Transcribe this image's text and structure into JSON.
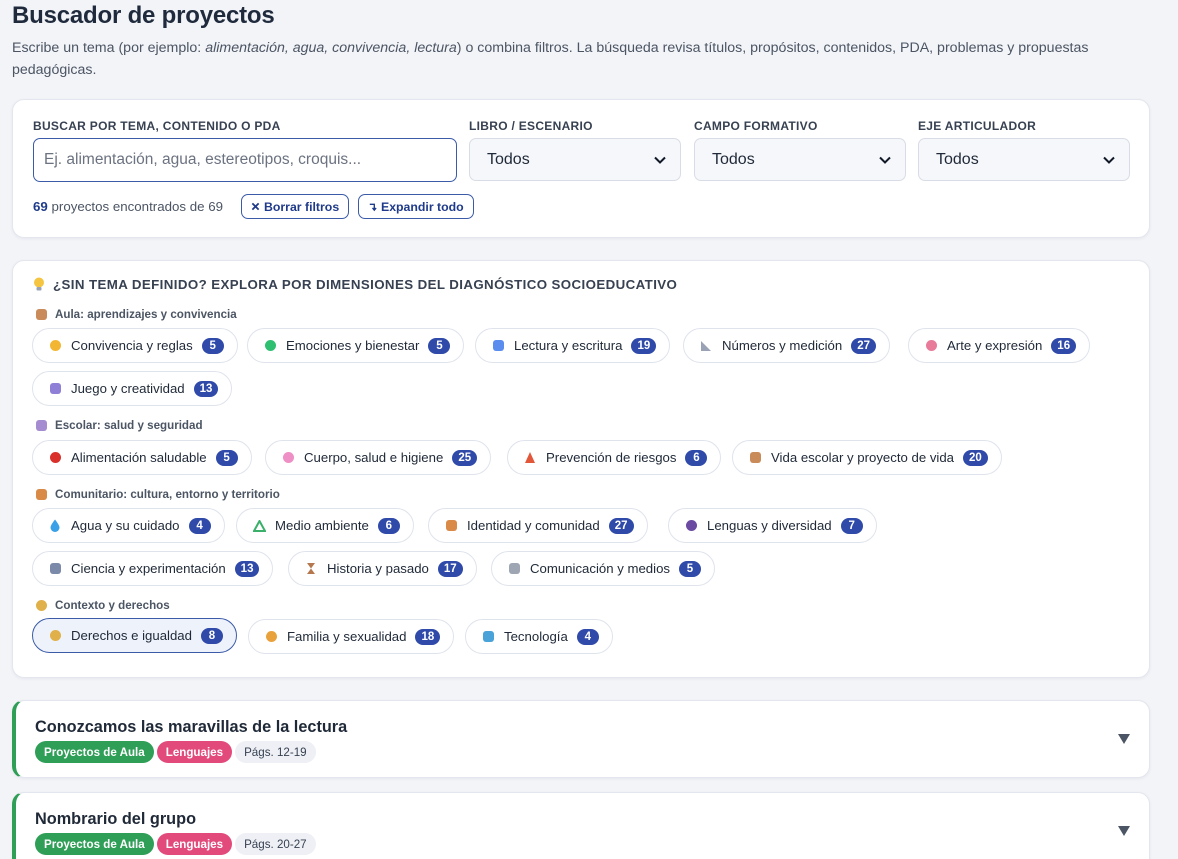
{
  "header": {
    "title": "Buscador de proyectos",
    "intro_a": "Escribe un tema (por ejemplo: ",
    "intro_examples": "alimentación, agua, convivencia, lectura",
    "intro_b": ") o combina filtros. La búsqueda revisa títulos, propósitos, contenidos, PDA, problemas y propuestas pedagógicas."
  },
  "filters": {
    "search_label": "BUSCAR POR TEMA, CONTENIDO O PDA",
    "search_placeholder": "Ej. alimentación, agua, estereotipos, croquis...",
    "search_value": "",
    "libro_label": "LIBRO / ESCENARIO",
    "libro_value": "Todos",
    "campo_label": "CAMPO FORMATIVO",
    "campo_value": "Todos",
    "eje_label": "EJE ARTICULADOR",
    "eje_value": "Todos",
    "count": "69",
    "count_text": "proyectos encontrados de 69",
    "clear_label": "Borrar filtros",
    "expand_label": "Expandir todo"
  },
  "explore": {
    "title": "¿SIN TEMA DEFINIDO? EXPLORA POR DIMENSIONES DEL DIAGNÓSTICO SOCIOEDUCATIVO",
    "title_icon": "lightbulb-icon",
    "groups": [
      {
        "label": "Aula: aprendizajes y convivencia",
        "icon": "school-icon",
        "chips": [
          {
            "label": "Convivencia y reglas",
            "count": "5",
            "icon": "handshake-icon",
            "color": "#f2b632"
          },
          {
            "label": "Emociones y bienestar",
            "count": "5",
            "icon": "heart-icon",
            "color": "#2fbf71"
          },
          {
            "label": "Lectura y escritura",
            "count": "19",
            "icon": "book-icon",
            "color": "#5b8def"
          },
          {
            "label": "Números y medición",
            "count": "27",
            "icon": "ruler-icon",
            "color": "#9aa3b5"
          },
          {
            "label": "Arte y expresión",
            "count": "16",
            "icon": "palette-icon",
            "color": "#e87a9a"
          },
          {
            "label": "Juego y creatividad",
            "count": "13",
            "icon": "dice-icon",
            "color": "#8f7fd6"
          }
        ]
      },
      {
        "label": "Escolar: salud y seguridad",
        "icon": "building-icon",
        "chips": [
          {
            "label": "Alimentación saludable",
            "count": "5",
            "icon": "apple-icon",
            "color": "#d9302c"
          },
          {
            "label": "Cuerpo, salud e higiene",
            "count": "25",
            "icon": "brain-icon",
            "color": "#ee8fc5"
          },
          {
            "label": "Prevención de riesgos",
            "count": "6",
            "icon": "cone-icon",
            "color": "#e2573a"
          },
          {
            "label": "Vida escolar y proyecto de vida",
            "count": "20",
            "icon": "school-icon",
            "color": "#c98b5a"
          }
        ]
      },
      {
        "label": "Comunitario: cultura, entorno y territorio",
        "icon": "houses-icon",
        "chips": [
          {
            "label": "Agua y su cuidado",
            "count": "4",
            "icon": "droplet-icon",
            "color": "#3aa0e8"
          },
          {
            "label": "Medio ambiente",
            "count": "6",
            "icon": "recycle-icon",
            "color": "#3bb06a"
          },
          {
            "label": "Identidad y comunidad",
            "count": "27",
            "icon": "houses-icon",
            "color": "#d98a47"
          },
          {
            "label": "Lenguas y diversidad",
            "count": "7",
            "icon": "speaking-head-icon",
            "color": "#6b4aa1"
          },
          {
            "label": "Ciencia y experimentación",
            "count": "13",
            "icon": "microscope-icon",
            "color": "#7a8aa8"
          },
          {
            "label": "Historia y pasado",
            "count": "17",
            "icon": "hourglass-icon",
            "color": "#b5784e"
          },
          {
            "label": "Comunicación y medios",
            "count": "5",
            "icon": "newspaper-icon",
            "color": "#9ea6b4"
          }
        ]
      },
      {
        "label": "Contexto y derechos",
        "icon": "scales-icon",
        "chips": [
          {
            "label": "Derechos e igualdad",
            "count": "8",
            "icon": "scales-icon",
            "color": "#e0b04a"
          },
          {
            "label": "Familia y sexualidad",
            "count": "18",
            "icon": "family-icon",
            "color": "#e9a23b"
          },
          {
            "label": "Tecnología",
            "count": "4",
            "icon": "computer-icon",
            "color": "#4aa3d8"
          }
        ]
      }
    ]
  },
  "projects": [
    {
      "title": "Conozcamos las maravillas de la lectura",
      "scenario": "Proyectos de Aula",
      "campo": "Lenguajes",
      "pages": "Págs. 12-19"
    },
    {
      "title": "Nombrario del grupo",
      "scenario": "Proyectos de Aula",
      "campo": "Lenguajes",
      "pages": "Págs. 20-27"
    }
  ],
  "colors": {
    "accent": "#2f4aa8",
    "aula_green": "#2f9e57",
    "lenguajes_pink": "#e24a7c"
  }
}
